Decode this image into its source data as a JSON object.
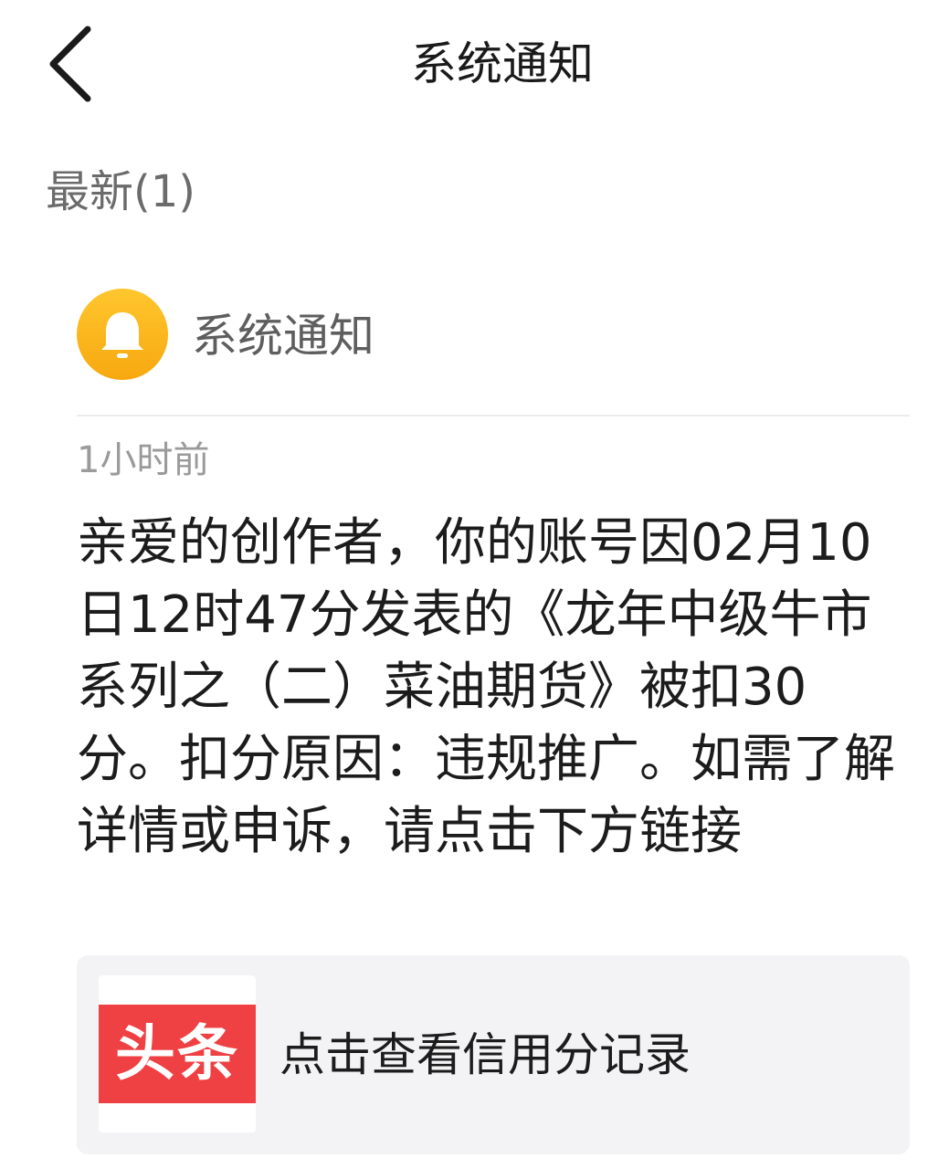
{
  "nav": {
    "back_icon": "chevron-left-icon",
    "title": "系统通知"
  },
  "section": {
    "label": "最新(1)"
  },
  "notification": {
    "avatar_icon": "bell-icon",
    "avatar_color": "#f9b51c",
    "sender": "系统通知",
    "time": "1小时前",
    "message": "亲爱的创作者，你的账号因02月10日12时47分发表的《龙年中级牛市系列之（二）菜油期货》被扣30分。扣分原因：违规推广。如需了解详情或申诉，请点击下方链接",
    "link": {
      "logo_text": "头条",
      "logo_color": "#ef4143",
      "label": "点击查看信用分记录"
    }
  }
}
